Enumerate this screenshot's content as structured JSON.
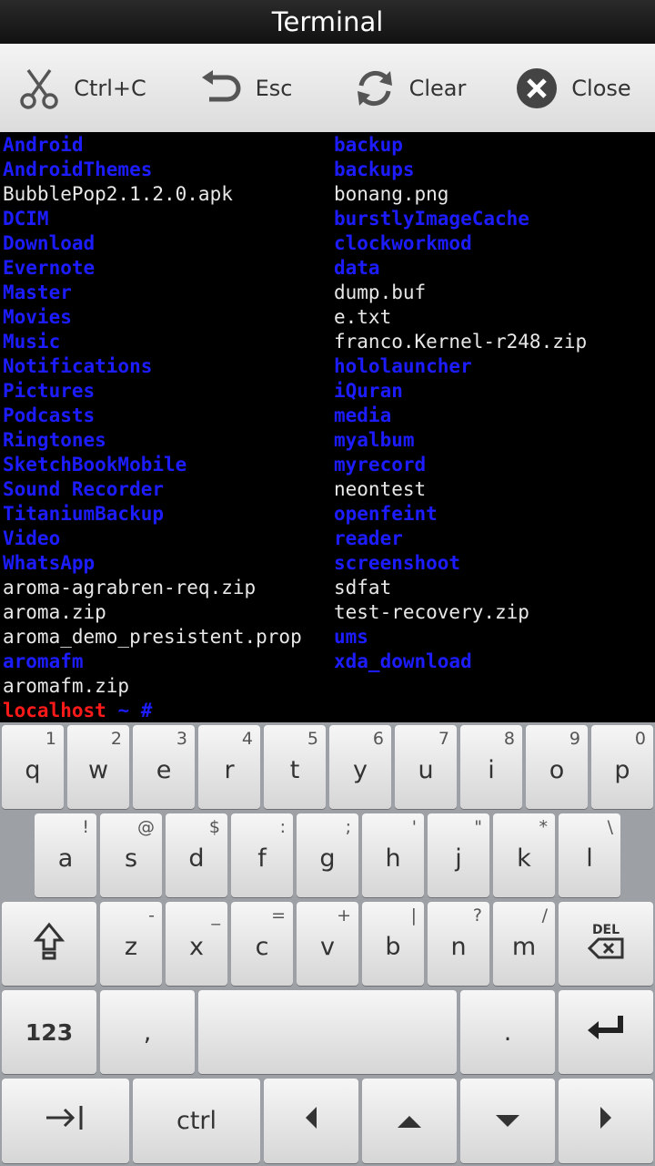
{
  "title": "Terminal",
  "toolbar": {
    "ctrlc_label": "Ctrl+C",
    "esc_label": "Esc",
    "clear_label": "Clear",
    "close_label": "Close"
  },
  "terminal": {
    "left_column": [
      {
        "text": "Android",
        "type": "dir"
      },
      {
        "text": "AndroidThemes",
        "type": "dir"
      },
      {
        "text": "BubblePop2.1.2.0.apk",
        "type": "file"
      },
      {
        "text": "DCIM",
        "type": "dir"
      },
      {
        "text": "Download",
        "type": "dir"
      },
      {
        "text": "Evernote",
        "type": "dir"
      },
      {
        "text": "Master",
        "type": "dir"
      },
      {
        "text": "Movies",
        "type": "dir"
      },
      {
        "text": "Music",
        "type": "dir"
      },
      {
        "text": "Notifications",
        "type": "dir"
      },
      {
        "text": "Pictures",
        "type": "dir"
      },
      {
        "text": "Podcasts",
        "type": "dir"
      },
      {
        "text": "Ringtones",
        "type": "dir"
      },
      {
        "text": "SketchBookMobile",
        "type": "dir"
      },
      {
        "text": "Sound Recorder",
        "type": "dir"
      },
      {
        "text": "TitaniumBackup",
        "type": "dir"
      },
      {
        "text": "Video",
        "type": "dir"
      },
      {
        "text": "WhatsApp",
        "type": "dir"
      },
      {
        "text": "aroma-agrabren-req.zip",
        "type": "file"
      },
      {
        "text": "aroma.zip",
        "type": "file"
      },
      {
        "text": "aroma_demo_presistent.prop",
        "type": "file"
      },
      {
        "text": "aromafm",
        "type": "dir"
      },
      {
        "text": "aromafm.zip",
        "type": "file"
      }
    ],
    "right_column": [
      {
        "text": "backup",
        "type": "dir"
      },
      {
        "text": "backups",
        "type": "dir"
      },
      {
        "text": "bonang.png",
        "type": "file"
      },
      {
        "text": "burstlyImageCache",
        "type": "dir"
      },
      {
        "text": "clockworkmod",
        "type": "dir"
      },
      {
        "text": "data",
        "type": "dir"
      },
      {
        "text": "dump.buf",
        "type": "file"
      },
      {
        "text": "e.txt",
        "type": "file"
      },
      {
        "text": "franco.Kernel-r248.zip",
        "type": "file"
      },
      {
        "text": "hololauncher",
        "type": "dir"
      },
      {
        "text": "iQuran",
        "type": "dir"
      },
      {
        "text": "media",
        "type": "dir"
      },
      {
        "text": "myalbum",
        "type": "dir"
      },
      {
        "text": "myrecord",
        "type": "dir"
      },
      {
        "text": "neontest",
        "type": "file"
      },
      {
        "text": "openfeint",
        "type": "dir"
      },
      {
        "text": "reader",
        "type": "dir"
      },
      {
        "text": "screenshoot",
        "type": "dir"
      },
      {
        "text": "sdfat",
        "type": "file"
      },
      {
        "text": "test-recovery.zip",
        "type": "file"
      },
      {
        "text": "ums",
        "type": "dir"
      },
      {
        "text": "xda_download",
        "type": "dir"
      }
    ],
    "prompt_host": "localhost",
    "prompt_rest": " ~ #"
  },
  "keyboard": {
    "row1": [
      {
        "main": "q",
        "sub": "1"
      },
      {
        "main": "w",
        "sub": "2"
      },
      {
        "main": "e",
        "sub": "3"
      },
      {
        "main": "r",
        "sub": "4"
      },
      {
        "main": "t",
        "sub": "5"
      },
      {
        "main": "y",
        "sub": "6"
      },
      {
        "main": "u",
        "sub": "7"
      },
      {
        "main": "i",
        "sub": "8"
      },
      {
        "main": "o",
        "sub": "9"
      },
      {
        "main": "p",
        "sub": "0"
      }
    ],
    "row2": [
      {
        "main": "a",
        "sub": "!"
      },
      {
        "main": "s",
        "sub": "@"
      },
      {
        "main": "d",
        "sub": "$"
      },
      {
        "main": "f",
        "sub": ":"
      },
      {
        "main": "g",
        "sub": ";"
      },
      {
        "main": "h",
        "sub": "'"
      },
      {
        "main": "j",
        "sub": "\""
      },
      {
        "main": "k",
        "sub": "*"
      },
      {
        "main": "l",
        "sub": "\\"
      }
    ],
    "row3": [
      {
        "main": "z",
        "sub": "-"
      },
      {
        "main": "x",
        "sub": "_"
      },
      {
        "main": "c",
        "sub": "="
      },
      {
        "main": "v",
        "sub": "+"
      },
      {
        "main": "b",
        "sub": "|"
      },
      {
        "main": "n",
        "sub": "?"
      },
      {
        "main": "m",
        "sub": "/"
      }
    ],
    "del_label": "DEL",
    "numbers_label": "123",
    "comma_label": ",",
    "period_label": ".",
    "ctrl_label": "ctrl"
  },
  "colors": {
    "directory": "#1c1cff",
    "file": "#e8e8e8",
    "prompt_host": "#ff1a1a"
  }
}
